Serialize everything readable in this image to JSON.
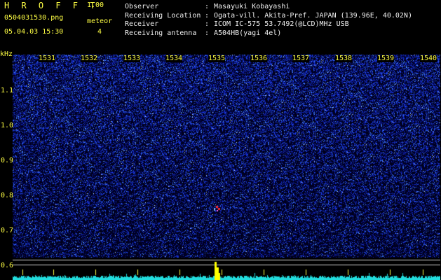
{
  "header": {
    "app_title": "H R O F F T",
    "app_version": "1.00",
    "file_name": "0504031530.png",
    "meteor_label": "meteor",
    "date_time": "05.04.03 15:30",
    "meteor_count": "4"
  },
  "info": {
    "rows": [
      {
        "label": "Observer",
        "sep": ":",
        "value": "Masayuki Kobayashi"
      },
      {
        "label": "Receiving Location",
        "sep": ":",
        "value": "Ogata-vill. Akita-Pref. JAPAN (139.96E, 40.02N)"
      },
      {
        "label": "Receiver",
        "sep": ":",
        "value": "ICOM IC-575 53.7492(@LCD)MHz USB"
      },
      {
        "label": "Receiving antenna",
        "sep": ":",
        "value": "A504HB(yagi 4el)"
      }
    ]
  },
  "axes": {
    "y_unit": "kHz",
    "y_ticks": [
      "1.1",
      "1.0",
      "0.9",
      "0.8",
      "0.7",
      "0.6"
    ],
    "time_labels": [
      "1531",
      "1532",
      "1533",
      "1534",
      "1535",
      "1536",
      "1537",
      "1538",
      "1539",
      "1540"
    ]
  },
  "colors": {
    "label_yellow": "#ffff44",
    "text_white": "#f0f0f0",
    "background": "#000000",
    "noise_blue": "#1a3bd6",
    "signal_cyan": "#22dddd",
    "meteor_yellow": "#ffff00",
    "meteor_red": "#ff2a2a",
    "reference_line": "#c8c8c8"
  },
  "events": [
    {
      "type": "meteor",
      "time": "1535",
      "freq_khz": 0.755
    }
  ]
}
